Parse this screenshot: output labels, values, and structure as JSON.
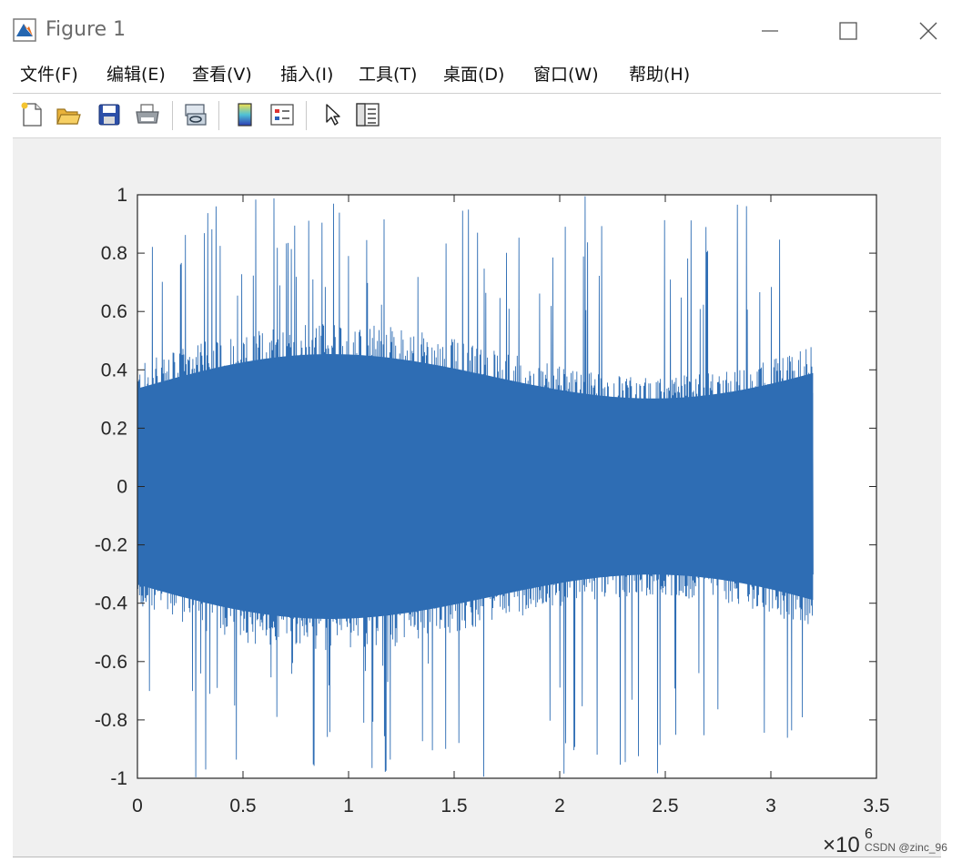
{
  "window": {
    "title": "Figure 1"
  },
  "menu": [
    {
      "label": "文件(F)",
      "name": "menu-file"
    },
    {
      "label": "编辑(E)",
      "name": "menu-edit"
    },
    {
      "label": "查看(V)",
      "name": "menu-view"
    },
    {
      "label": "插入(I)",
      "name": "menu-insert"
    },
    {
      "label": "工具(T)",
      "name": "menu-tools"
    },
    {
      "label": "桌面(D)",
      "name": "menu-desktop"
    },
    {
      "label": "窗口(W)",
      "name": "menu-window"
    },
    {
      "label": "帮助(H)",
      "name": "menu-help"
    }
  ],
  "toolbar": {
    "buttons": [
      {
        "icon": "new-figure-icon"
      },
      {
        "icon": "open-folder-icon"
      },
      {
        "icon": "save-icon"
      },
      {
        "icon": "print-icon"
      },
      {
        "icon": "link-plot-icon"
      },
      {
        "icon": "colorbar-icon"
      },
      {
        "icon": "legend-icon"
      },
      {
        "icon": "pointer-icon"
      },
      {
        "icon": "property-editor-icon"
      }
    ]
  },
  "colors": {
    "signal": "#2e6db4",
    "figure_bg": "#f0f0f0",
    "axes_bg": "#ffffff"
  },
  "chart_data": {
    "type": "line",
    "title": "",
    "xlabel": "",
    "ylabel": "",
    "series": [
      {
        "values_note": "",
        "data_extent_x": [
          0,
          3200000
        ]
      }
    ],
    "x_tick_labels": [
      "0",
      "0.5",
      "1",
      "1.5",
      "2",
      "2.5",
      "3",
      "3.5"
    ],
    "y_tick_labels": [
      "1",
      "0.8",
      "0.6",
      "0.4",
      "0.2",
      "0",
      "-0.2",
      "-0.4",
      "-0.6",
      "-0.8",
      "-1"
    ],
    "xlim": [
      0,
      3500000
    ],
    "ylim": [
      -1,
      1
    ],
    "x_exponent": {
      "base": "×10",
      "power": "6"
    },
    "grid": false,
    "legend": "none"
  },
  "watermark": "CSDN @zinc_96"
}
